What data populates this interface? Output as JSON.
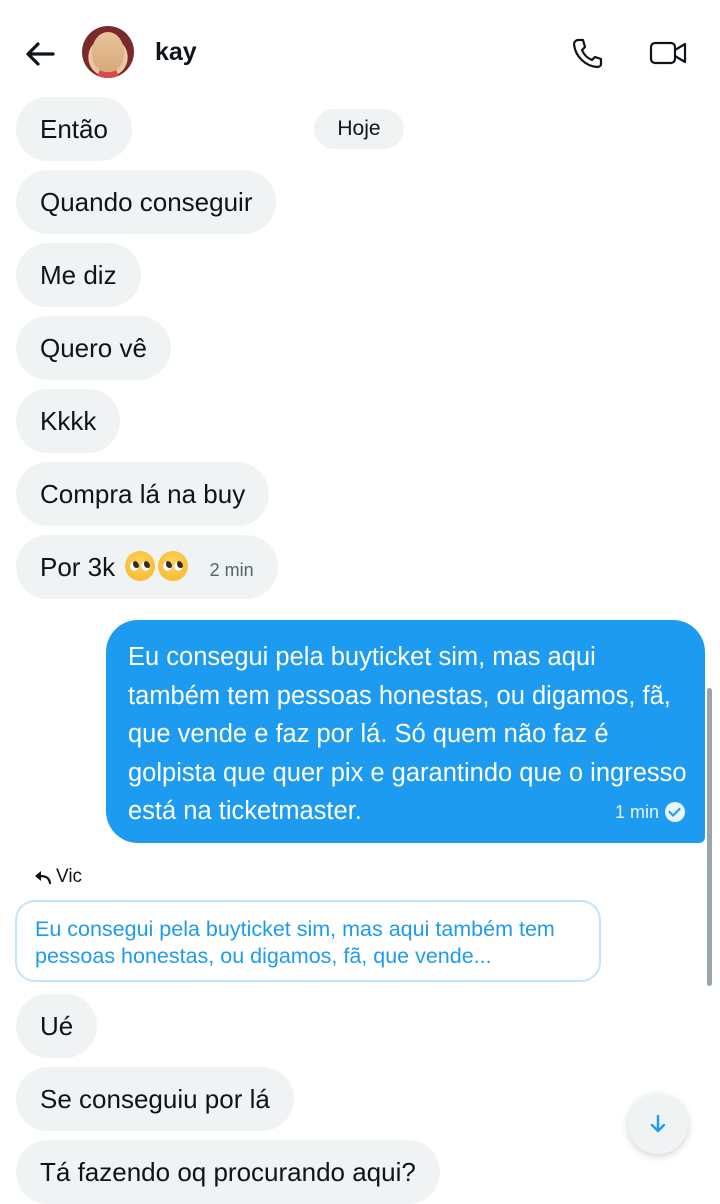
{
  "header": {
    "contact_name": "kay",
    "back_icon": "arrow-left-icon",
    "call_icon": "phone-icon",
    "video_icon": "video-camera-icon"
  },
  "day_divider": "Hoje",
  "incoming_messages": [
    "Então",
    "Quando conseguir",
    "Me diz",
    "Quero vê",
    "Kkkk",
    "Compra lá na buy",
    "Por 3k"
  ],
  "incoming_last_time": "2 min",
  "outgoing_message": {
    "text": "Eu consegui pela buyticket sim, mas aqui também tem pessoas honestas, ou digamos, fã, que vende e faz por lá. Só quem não faz é golpista que quer pix e garantindo que o ingresso está na ticketmaster.",
    "time": "1 min",
    "status_icon": "check-circle-icon"
  },
  "reply": {
    "label": "Vic",
    "quoted_text": "Eu consegui pela buyticket sim, mas aqui também tem pessoas honestas, ou digamos, fã, que vende..."
  },
  "later_messages": [
    "Ué",
    "Se conseguiu por lá",
    "Tá fazendo oq procurando aqui?"
  ],
  "colors": {
    "accent": "#1d9bf0",
    "incoming_bubble": "#eff3f4"
  }
}
